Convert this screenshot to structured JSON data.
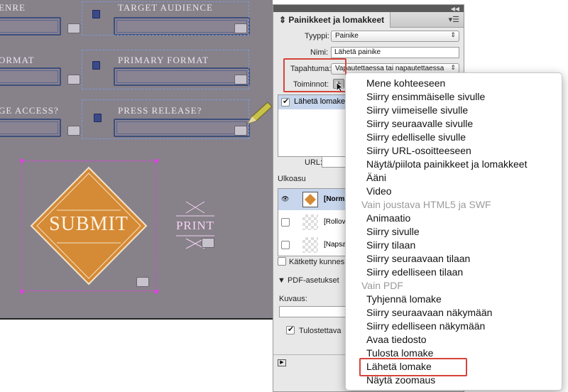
{
  "canvas": {
    "headers": [
      "ENRE",
      "TARGET AUDIENCE",
      "ORMAT",
      "PRIMARY FORMAT",
      "GE ACCESS?",
      "PRESS RELEASE?"
    ],
    "submit_label": "SUBMIT",
    "print_label": "PRINT"
  },
  "panel": {
    "title": "Painikkeet ja lomakkeet",
    "type_label": "Tyyppi:",
    "type_value": "Painike",
    "name_label": "Nimi:",
    "name_value": "Lähetä painike",
    "event_label": "Tapahtuma:",
    "event_value": "Vapautettaessa tai napautettaessa",
    "actions_label": "Toiminnot:",
    "action_item": "Lähetä lomake",
    "url_label": "URL:",
    "appearance_label": "Ulkoasu",
    "states": [
      "[Norm",
      "[Rollov",
      "[Napsa"
    ],
    "hidden_label": "Kätketty kunnes li",
    "pdf_section": "PDF-asetukset",
    "description_label": "Kuvaus:",
    "printable_label": "Tulostettava"
  },
  "menu": {
    "items": [
      {
        "label": "Mene kohteeseen",
        "enabled": true
      },
      {
        "label": "Siirry ensimmäiselle sivulle",
        "enabled": true
      },
      {
        "label": "Siirry viimeiselle sivulle",
        "enabled": true
      },
      {
        "label": "Siirry seuraavalle sivulle",
        "enabled": true
      },
      {
        "label": "Siirry edelliselle sivulle",
        "enabled": true
      },
      {
        "label": "Siirry URL-osoitteeseen",
        "enabled": true
      },
      {
        "label": "Näytä/piilota painikkeet ja lomakkeet",
        "enabled": true
      },
      {
        "label": "Ääni",
        "enabled": true
      },
      {
        "label": "Video",
        "enabled": true
      },
      {
        "label": "Vain joustava HTML5 ja SWF",
        "enabled": false
      },
      {
        "label": "Animaatio",
        "enabled": true
      },
      {
        "label": "Siirry sivulle",
        "enabled": true
      },
      {
        "label": "Siirry tilaan",
        "enabled": true
      },
      {
        "label": "Siirry seuraavaan tilaan",
        "enabled": true
      },
      {
        "label": "Siirry edelliseen tilaan",
        "enabled": true
      },
      {
        "label": "Vain PDF",
        "enabled": false
      },
      {
        "label": "Tyhjennä lomake",
        "enabled": true
      },
      {
        "label": "Siirry seuraavaan näkymään",
        "enabled": true
      },
      {
        "label": "Siirry edelliseen näkymään",
        "enabled": true
      },
      {
        "label": "Avaa tiedosto",
        "enabled": true
      },
      {
        "label": "Tulosta lomake",
        "enabled": true
      },
      {
        "label": "Lähetä lomake",
        "enabled": true
      },
      {
        "label": "Näytä zoomaus",
        "enabled": true
      }
    ]
  },
  "colors": {
    "highlight_box": "#d7443a",
    "submit_fill": "#d58a35",
    "canvas_bg": "#87818a",
    "selection": "#e040e0"
  }
}
